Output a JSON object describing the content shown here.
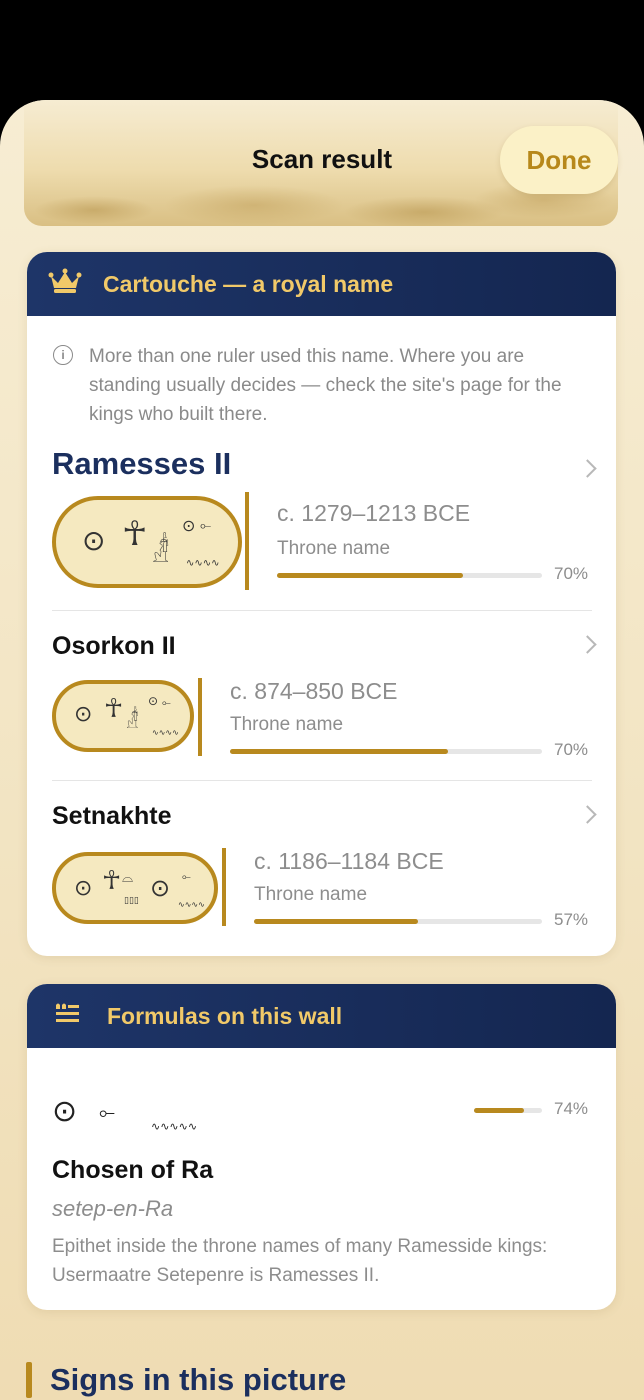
{
  "header": {
    "title": "Scan result",
    "done_label": "Done"
  },
  "cartouche_card": {
    "heading": "Cartouche — a royal name",
    "note": "More than one ruler used this name. Where you are standing usually decides — check the site's page for the kings who built there.",
    "rulers": [
      {
        "name": "Ramesses II",
        "date": "c. 1279–1213 BCE",
        "kind": "Throne name",
        "confidence": 0.7,
        "pct_label": "70%"
      },
      {
        "name": "Osorkon II",
        "date": "c. 874–850 BCE",
        "kind": "Throne name",
        "confidence": 0.7,
        "pct_label": "70%"
      },
      {
        "name": "Setnakhte",
        "date": "c. 1186–1184 BCE",
        "kind": "Throne name",
        "confidence": 0.57,
        "pct_label": "57%"
      }
    ]
  },
  "formulas_card": {
    "heading": "Formulas on this wall",
    "items": [
      {
        "title": "Chosen of Ra",
        "transliteration": "setep-en-Ra",
        "description": "Epithet inside the throne names of many Ramesside kings: Usermaatre Setepenre is Ramesses II.",
        "confidence": 0.74,
        "pct_label": "74%"
      }
    ]
  },
  "signs_section": {
    "title": "Signs in this picture"
  },
  "colors": {
    "navy": "#1b2f5e",
    "gold": "#b8891e"
  },
  "icons": [
    "crown-icon",
    "info-icon",
    "chevron-right-icon",
    "formula-list-icon"
  ]
}
